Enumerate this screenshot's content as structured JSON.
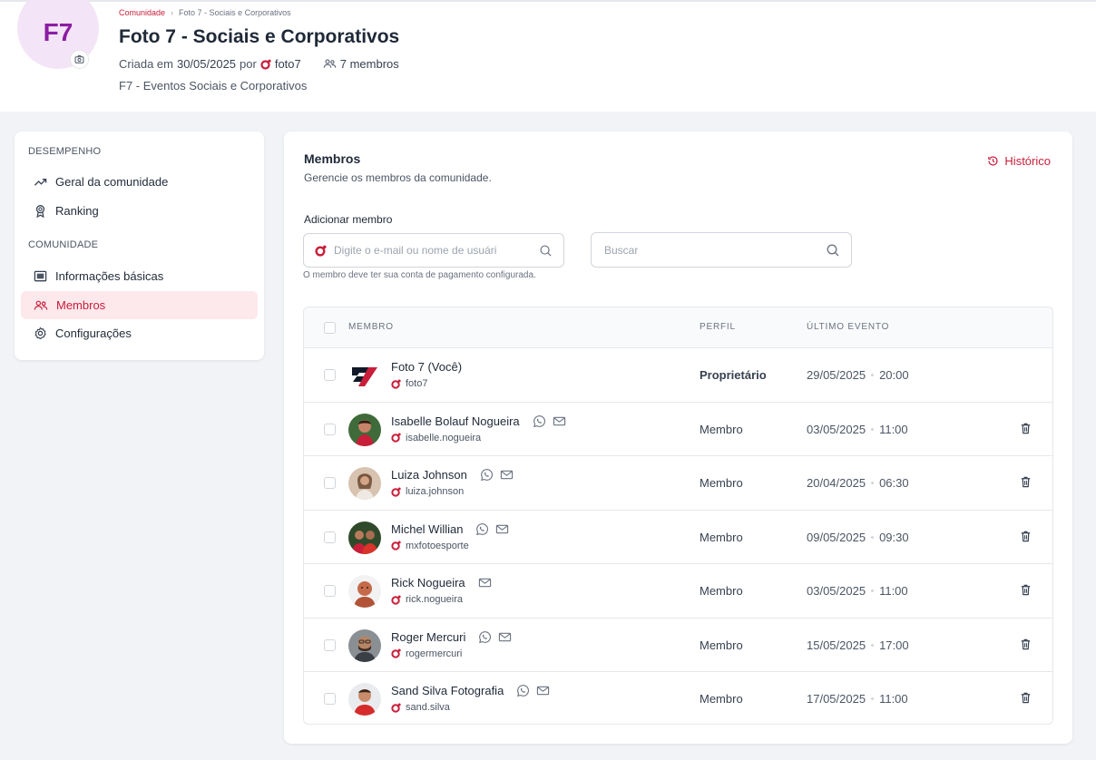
{
  "header": {
    "avatar_initials": "F7",
    "breadcrumb": {
      "parent": "Comunidade",
      "current": "Foto 7 - Sociais e Corporativos"
    },
    "title": "Foto 7 - Sociais e Corporativos",
    "created_prefix": "Criada em",
    "created_date": "30/05/2025",
    "created_by_prefix": "por",
    "created_by": "foto7",
    "members_count": "7 membros",
    "description": "F7 - Eventos Sociais e Corporativos"
  },
  "sidebar": {
    "section_performance": "DESEMPENHO",
    "section_community": "COMUNIDADE",
    "items": [
      {
        "label": "Geral da comunidade",
        "icon": "trend-icon"
      },
      {
        "label": "Ranking",
        "icon": "medal-icon"
      },
      {
        "label": "Informações básicas",
        "icon": "card-icon"
      },
      {
        "label": "Membros",
        "icon": "users-icon",
        "active": true
      },
      {
        "label": "Configurações",
        "icon": "gear-icon"
      }
    ]
  },
  "main": {
    "title": "Membros",
    "description": "Gerencie os membros da comunidade.",
    "history_label": "Histórico",
    "add_label": "Adicionar membro",
    "add_placeholder": "Digite o e-mail ou nome de usuári",
    "add_hint": "O membro deve ter sua conta de pagamento configurada.",
    "search_placeholder": "Buscar",
    "table": {
      "headers": {
        "member": "MEMBRO",
        "role": "PERFIL",
        "last_event": "ÚLTIMO EVENTO"
      },
      "rows": [
        {
          "name": "Foto 7 (Você)",
          "username": "foto7",
          "role": "Proprietário",
          "date": "29/05/2025",
          "time": "20:00",
          "whatsapp": false,
          "email": false,
          "deletable": false
        },
        {
          "name": "Isabelle Bolauf Nogueira",
          "username": "isabelle.nogueira",
          "role": "Membro",
          "date": "03/05/2025",
          "time": "11:00",
          "whatsapp": true,
          "email": true,
          "deletable": true
        },
        {
          "name": "Luiza Johnson",
          "username": "luiza.johnson",
          "role": "Membro",
          "date": "20/04/2025",
          "time": "06:30",
          "whatsapp": true,
          "email": true,
          "deletable": true
        },
        {
          "name": "Michel Willian",
          "username": "mxfotoesporte",
          "role": "Membro",
          "date": "09/05/2025",
          "time": "09:30",
          "whatsapp": true,
          "email": true,
          "deletable": true
        },
        {
          "name": "Rick Nogueira",
          "username": "rick.nogueira",
          "role": "Membro",
          "date": "03/05/2025",
          "time": "11:00",
          "whatsapp": false,
          "email": true,
          "deletable": true
        },
        {
          "name": "Roger Mercuri",
          "username": "rogermercuri",
          "role": "Membro",
          "date": "15/05/2025",
          "time": "17:00",
          "whatsapp": true,
          "email": true,
          "deletable": true
        },
        {
          "name": "Sand Silva Fotografia",
          "username": "sand.silva",
          "role": "Membro",
          "date": "17/05/2025",
          "time": "11:00",
          "whatsapp": true,
          "email": true,
          "deletable": true
        }
      ]
    }
  },
  "colors": {
    "accent": "#c81e3a",
    "avatar_bg": "#f3e5f7",
    "avatar_text": "#8b1ea3",
    "active_bg": "#fde8ec"
  }
}
